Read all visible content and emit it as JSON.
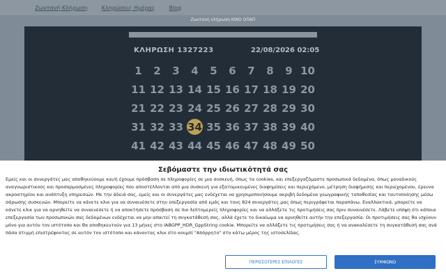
{
  "nav": {
    "items": [
      "Ζωντανή Κλήρωση",
      "Κληρώσεις Ημέρας",
      "Blog"
    ]
  },
  "subtitle": "Ζωντανή κλήρωση ΚΙΝΟ ΟΠΑΠ",
  "draw": {
    "label": "ΚΛΗΡΩΣΗ 1327223",
    "datetime": "22/08/2026 02:05"
  },
  "numbers": [
    "1",
    "2",
    "3",
    "4",
    "5",
    "6",
    "7",
    "8",
    "9",
    "10",
    "11",
    "12",
    "13",
    "14",
    "15",
    "16",
    "17",
    "18",
    "19",
    "20",
    "21",
    "22",
    "23",
    "24",
    "25",
    "26",
    "27",
    "28",
    "29",
    "30",
    "31",
    "32",
    "33",
    "34",
    "35",
    "36",
    "37",
    "38",
    "39",
    "40",
    "41",
    "42",
    "43",
    "44",
    "45",
    "46",
    "47",
    "48",
    "49",
    "50"
  ],
  "drawn_numbers": [
    "34"
  ],
  "consent": {
    "title": "Σεβόμαστε την ιδιωτικότητά σας",
    "text": "Εμείς και οι συνεργάτες μας αποθηκεύουμε και/ή έχουμε πρόσβαση σε πληροφορίες σε μια συσκευή, όπως τα cookies, και επεξεργαζόμαστε προσωπικά δεδομένα, όπως μοναδικούς αναγνωριστικούς και προσαρμοσμένες πληροφορίες που αποστέλλονται από μια συσκευή για εξατομικευμένες διαφημίσεις και περιεχόμενο, μέτρηση διαφήμισης και περιεχομένου, έρευνα ακροατηρίου και ανάπτυξη υπηρεσιών. Με την άδειά σας, εμείς και οι συνεργάτες μας ενδέχεται να χρησιμοποιήσουμε ακριβή δεδομένα γεωγραφικής τοποθεσίας και ταυτοποίησης μέσω σάρωσης συσκευών. Μπορείτε να κάνετε κλικ για να συναινέσετε στην επεξεργασία από εμάς και τους 824 συνεργάτες μας όπως περιγράφεται παραπάνω. Εναλλακτικά, μπορείτε να κάνετε κλικ για να αρνηθείτε να συναινέσετε ή να αποκτήσετε πρόσβαση σε πιο λεπτομερείς πληροφορίες και να αλλάξετε τις προτιμήσεις σας πριν συναινέσετε. Λάβετε υπόψη ότι κάποια επεξεργασία των προσωπικών σας δεδομένων ενδέχεται να μην απαιτεί τη συγκατάθεσή σας, αλλά έχετε το δικαίωμα να αρνηθείτε αυτήν την επεξεργασία. Οι προτιμήσεις σας θα ισχύουν μόνο για αυτόν τον ιστότοπο και θα αποθηκευτούν για 13 μήνες στο IABGPP_HDR_GppString cookie. Μπορείτε να αλλάξετε τις προτιμήσεις σας ή να ανακαλέσετε τη συγκατάθεσή σας ανά πάσα στιγμή επιστρέφοντας σε αυτόν τον ιστότοπο και κάνοντας κλικ στο κουμπί \"Απόρρητο\" στο κάτω μέρος της ιστοσελίδας.",
    "more_options_label": "ΠΕΡΙΣΣΟΤΕΡΕΣ ΕΠΙΛΟΓΕΣ",
    "agree_label": "ΣΥΜΦΩΝΩ"
  }
}
